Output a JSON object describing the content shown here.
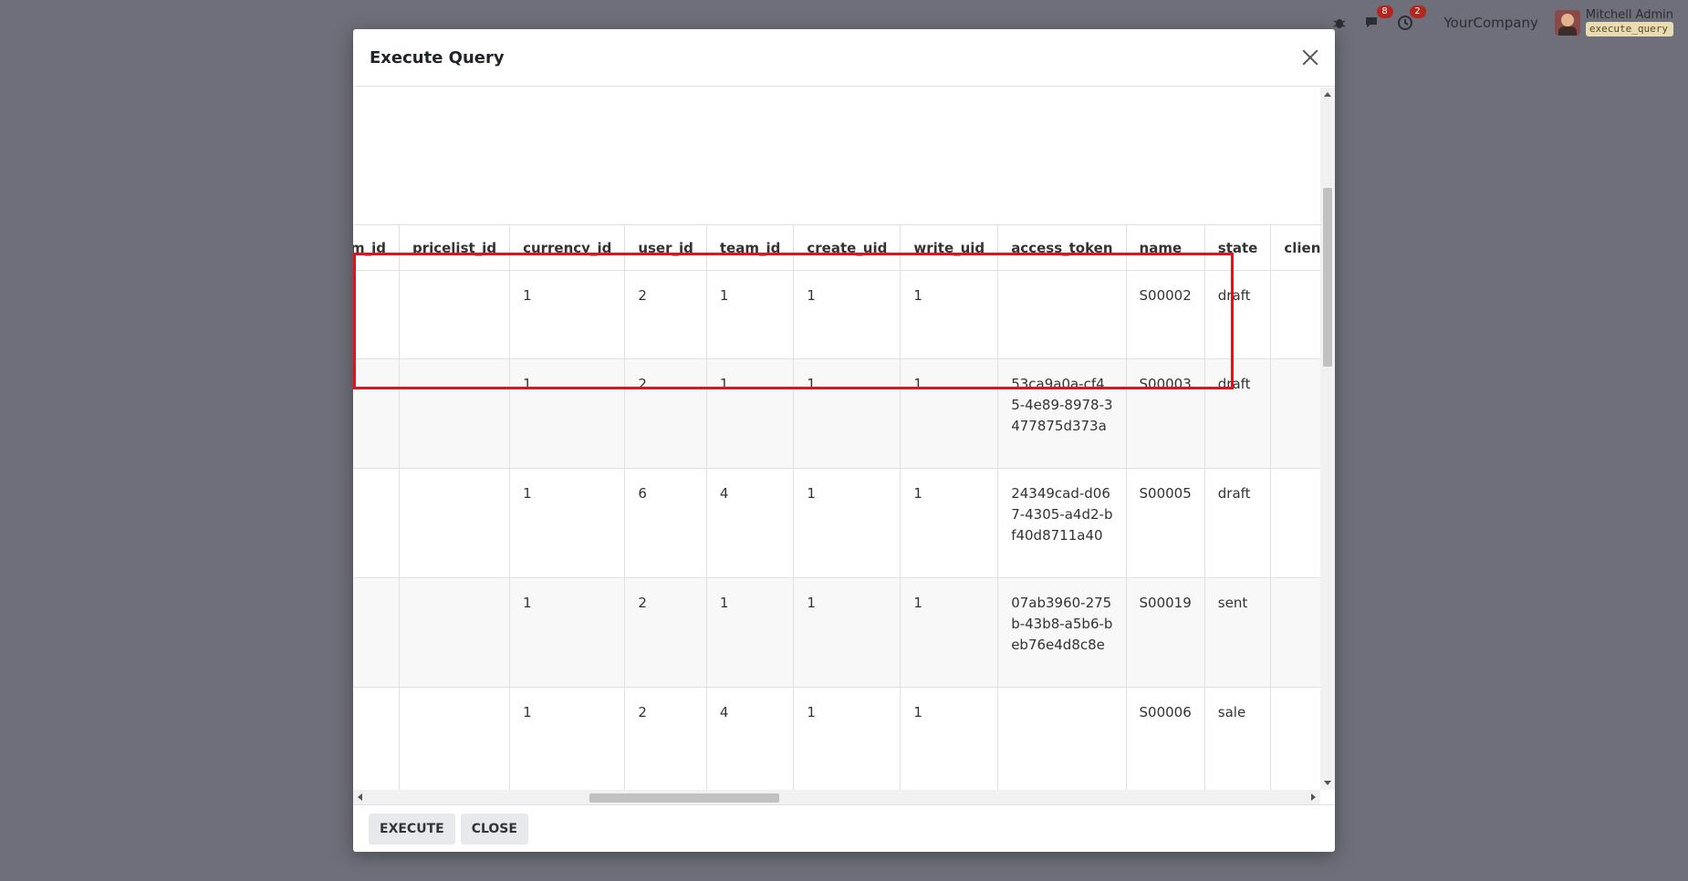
{
  "navbar": {
    "bug_icon": "bug-icon",
    "messages_badge": "8",
    "activities_badge": "2",
    "company": "YourCompany",
    "user_name": "Mitchell Admin",
    "database": "execute_query"
  },
  "modal": {
    "title": "Execute Query",
    "execute_label": "EXECUTE",
    "close_label": "CLOSE"
  },
  "table": {
    "columns": [
      "nent_term_id",
      "pricelist_id",
      "currency_id",
      "user_id",
      "team_id",
      "create_uid",
      "write_uid",
      "access_token",
      "name",
      "state",
      "client_order"
    ],
    "rows": [
      [
        "",
        "",
        "1",
        "2",
        "1",
        "1",
        "1",
        "",
        "S00002",
        "draft",
        ""
      ],
      [
        "",
        "",
        "1",
        "2",
        "1",
        "1",
        "1",
        "53ca9a0a-cf45-4e89-8978-3477875d373a",
        "S00003",
        "draft",
        ""
      ],
      [
        "",
        "",
        "1",
        "6",
        "4",
        "1",
        "1",
        "24349cad-d067-4305-a4d2-bf40d8711a40",
        "S00005",
        "draft",
        ""
      ],
      [
        "",
        "",
        "1",
        "2",
        "1",
        "1",
        "1",
        "07ab3960-275b-43b8-a5b6-beb76e4d8c8e",
        "S00019",
        "sent",
        ""
      ],
      [
        "",
        "",
        "1",
        "2",
        "4",
        "1",
        "1",
        "",
        "S00006",
        "sale",
        ""
      ]
    ]
  },
  "colors": {
    "highlight": "#e0141e",
    "backdrop": "#6e6f7a"
  }
}
